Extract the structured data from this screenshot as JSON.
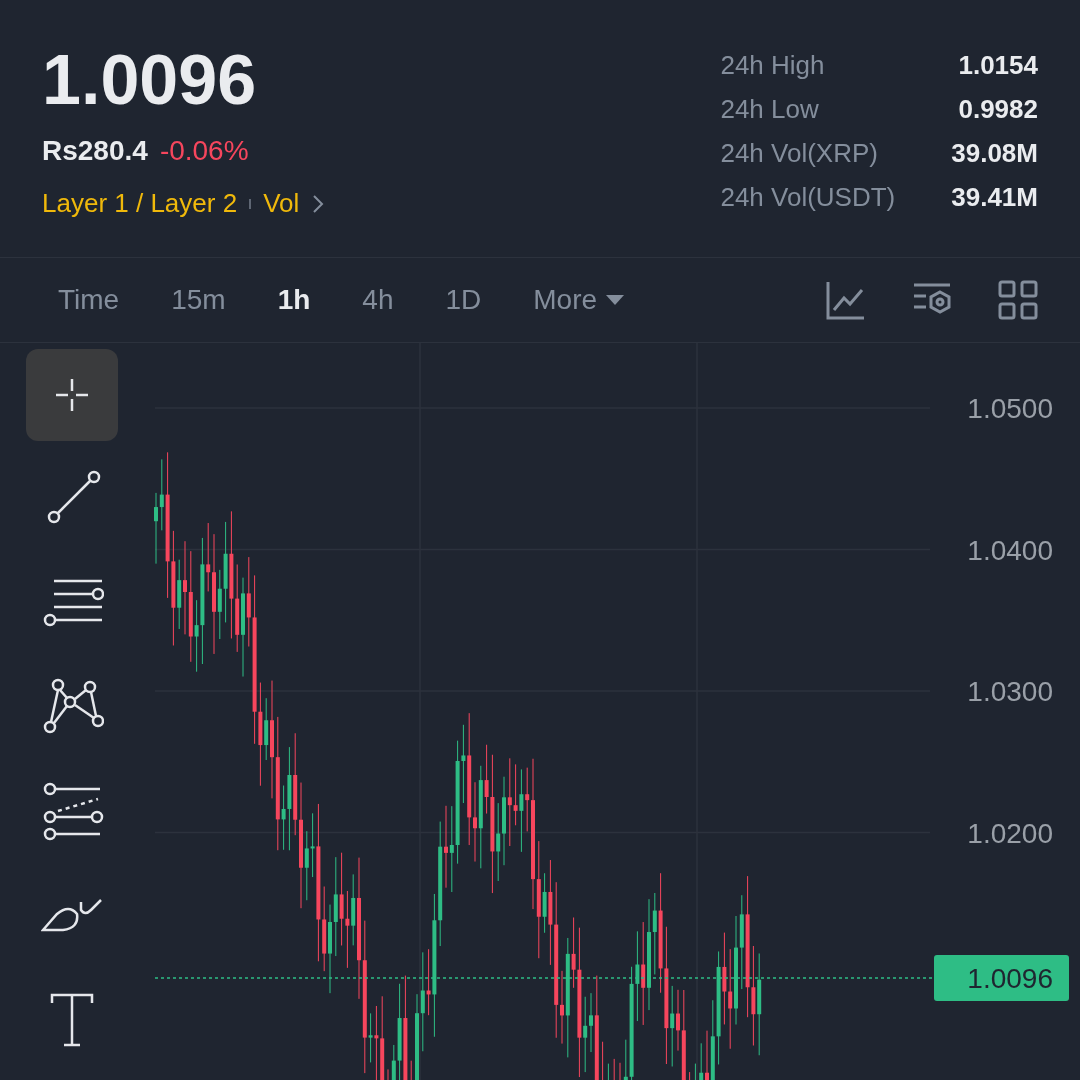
{
  "ticker": {
    "price": "1.0096",
    "fiat_price": "Rs280.4",
    "change": "-0.06%",
    "tags": [
      "Layer 1 / Layer 2",
      "Vol"
    ]
  },
  "stats": [
    {
      "label": "24h High",
      "value": "1.0154"
    },
    {
      "label": "24h Low",
      "value": "0.9982"
    },
    {
      "label": "24h Vol(XRP)",
      "value": "39.08M"
    },
    {
      "label": "24h Vol(USDT)",
      "value": "39.41M"
    }
  ],
  "intervals": [
    {
      "label": "Time",
      "selected": false
    },
    {
      "label": "15m",
      "selected": false
    },
    {
      "label": "1h",
      "selected": true
    },
    {
      "label": "4h",
      "selected": false
    },
    {
      "label": "1D",
      "selected": false
    },
    {
      "label": "More",
      "selected": false
    }
  ],
  "tools": [
    {
      "kind": "crosshair",
      "selected": true
    },
    {
      "kind": "trendline",
      "selected": false
    },
    {
      "kind": "hlines",
      "selected": false
    },
    {
      "kind": "pattern",
      "selected": false
    },
    {
      "kind": "fib",
      "selected": false
    },
    {
      "kind": "brush",
      "selected": false
    },
    {
      "kind": "text",
      "selected": false
    }
  ],
  "chart": {
    "y_labels": [
      "1.0500",
      "1.0400",
      "1.0300",
      "1.0200"
    ],
    "last_price": "1.0096"
  }
}
